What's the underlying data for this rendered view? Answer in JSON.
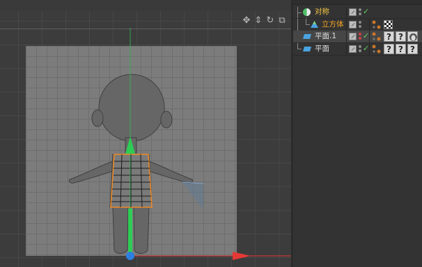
{
  "viewport": {
    "nav_icons": [
      "move-view-icon",
      "zoom-view-icon",
      "rotate-view-icon",
      "maximize-view-icon"
    ]
  },
  "object_manager": {
    "rows": [
      {
        "name": "对称",
        "type": "symmetry",
        "name_color": "#f5c542",
        "checked": true
      },
      {
        "name": "立方体",
        "type": "cube",
        "name_color": "#f5a623",
        "child_of": "对称",
        "tag": "checker"
      },
      {
        "name": "平面.1",
        "type": "plane",
        "name_color": "#e0e0e0",
        "selected": true,
        "tags": [
          "phong",
          "unknown",
          "unknown",
          "material"
        ]
      },
      {
        "name": "平面",
        "type": "plane",
        "name_color": "#e0e0e0",
        "tags": [
          "phong",
          "unknown",
          "unknown",
          "unknown"
        ]
      }
    ],
    "unknown_tag_glyph": "?"
  },
  "colors": {
    "x_axis": "#e53935",
    "y_axis": "#2ecc55",
    "z_axis": "#2f7fe0",
    "selection": "#f08a24"
  }
}
